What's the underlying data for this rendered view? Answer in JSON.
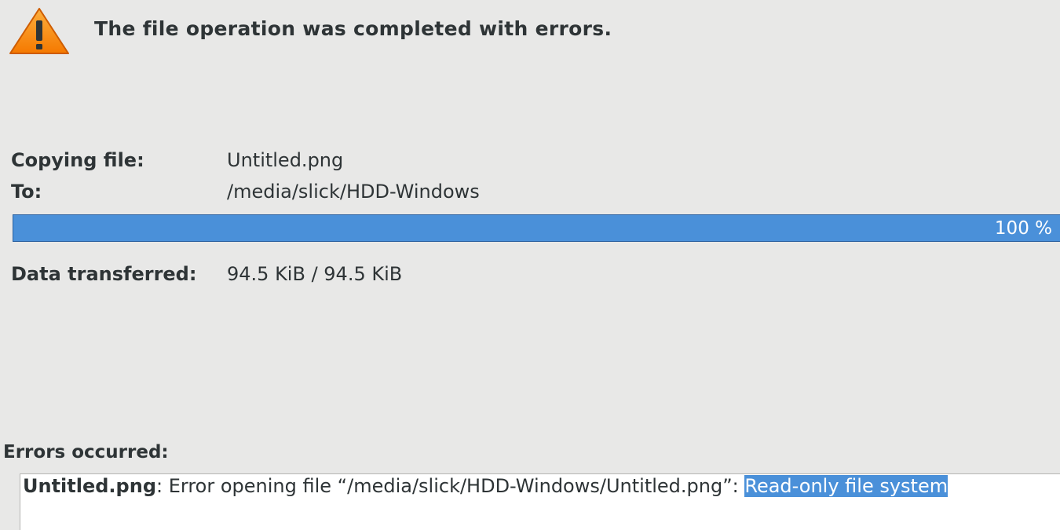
{
  "header": {
    "icon": "warning-icon",
    "title": "The file operation was completed with errors."
  },
  "details": {
    "copying_label": "Copying file:",
    "copying_value": "Untitled.png",
    "to_label": "To:",
    "to_value": "/media/slick/HDD-Windows",
    "progress_percent": 100,
    "progress_text": "100 %",
    "transferred_label": "Data transferred:",
    "transferred_value": "94.5 KiB / 94.5 KiB"
  },
  "errors": {
    "label": "Errors occurred:",
    "file": "Untitled.png",
    "separator": ":",
    "message": " Error opening file “/media/slick/HDD-Windows/Untitled.png”: ",
    "reason": "Read-only file system"
  },
  "colors": {
    "accent": "#4a90d9",
    "warning": "#f57900",
    "background": "#e8e8e7"
  }
}
